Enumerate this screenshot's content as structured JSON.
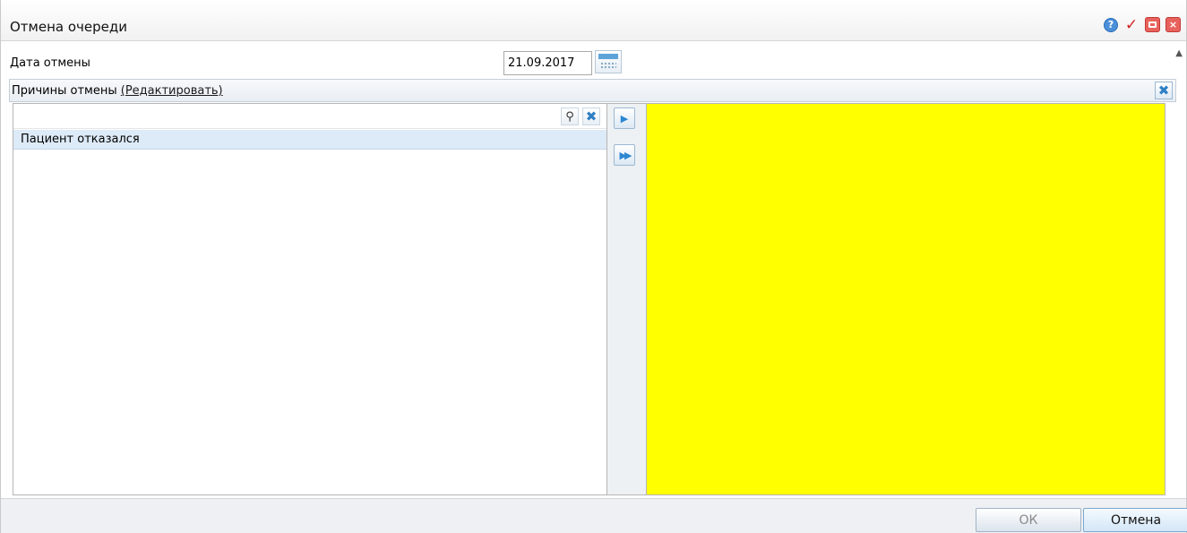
{
  "window": {
    "title": "Отмена очереди",
    "icons": [
      "help-icon",
      "check-icon",
      "minimize-icon",
      "close-icon"
    ]
  },
  "form": {
    "date_label": "Дата отмены",
    "date_value": "21.09.2017"
  },
  "reasons": {
    "label": "Причины отмены",
    "edit_link": "(Редактировать)",
    "available": [
      "Пациент отказался"
    ],
    "selected": []
  },
  "colors": {
    "selected_panel_bg": "#ffff00",
    "accent": "#2f86d1"
  },
  "footer": {
    "ok_label": "ОК",
    "cancel_label": "Отмена"
  }
}
